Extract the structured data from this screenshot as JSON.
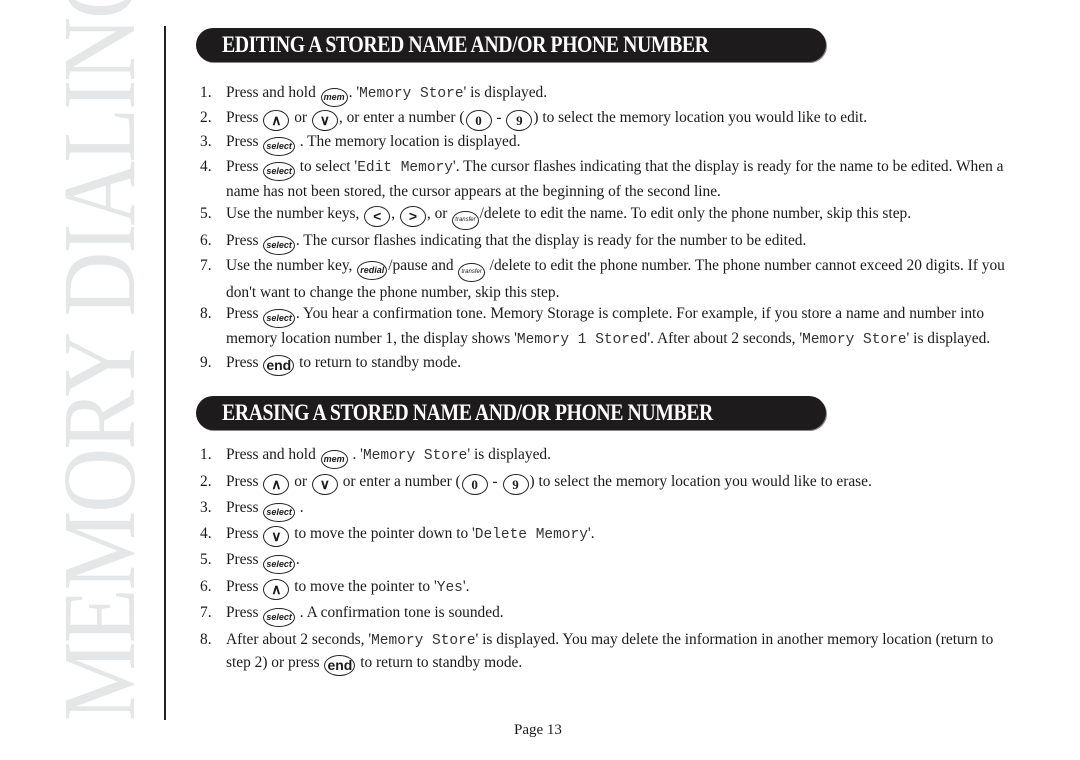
{
  "side_title": "MEMORY DIALING",
  "section1": {
    "title": "EDITING A STORED NAME AND/OR PHONE NUMBER",
    "steps": [
      {
        "n": "1.",
        "parts": [
          {
            "t": "Press and hold "
          },
          {
            "k": "mem"
          },
          {
            "t": ". '"
          },
          {
            "m": "Memory Store"
          },
          {
            "t": "' is displayed."
          }
        ]
      },
      {
        "n": "2.",
        "parts": [
          {
            "t": "Press "
          },
          {
            "k": "∧",
            "c": "big"
          },
          {
            "t": " or "
          },
          {
            "k": "∨",
            "c": "big"
          },
          {
            "t": ", or enter a number ("
          },
          {
            "k": "0",
            "c": "big digit"
          },
          {
            "t": " - "
          },
          {
            "k": "9",
            "c": "big digit"
          },
          {
            "t": ") to select the memory location you would like to edit."
          }
        ]
      },
      {
        "n": "3.",
        "parts": [
          {
            "t": "Press "
          },
          {
            "k": "select"
          },
          {
            "t": " . The memory location is displayed."
          }
        ]
      },
      {
        "n": "4.",
        "parts": [
          {
            "t": "Press "
          },
          {
            "k": "select"
          },
          {
            "t": " to select '"
          },
          {
            "m": "Edit Memory"
          },
          {
            "t": "'. The cursor flashes indicating that the display is ready for the name to be edited. When a name has not been stored, the cursor appears at the beginning of the second line."
          }
        ]
      },
      {
        "n": "5.",
        "parts": [
          {
            "t": "Use the number keys, "
          },
          {
            "k": "<",
            "c": "big"
          },
          {
            "t": ", "
          },
          {
            "k": ">",
            "c": "big"
          },
          {
            "t": ", or  "
          },
          {
            "k": "transfer",
            "c": "tiny"
          },
          {
            "t": "/delete to edit the name. To edit only the phone number, skip this step."
          }
        ]
      },
      {
        "n": "6.",
        "parts": [
          {
            "t": "Press "
          },
          {
            "k": "select"
          },
          {
            "t": ". The cursor flashes indicating that the display is ready for the number to be edited."
          }
        ]
      },
      {
        "n": "7.",
        "parts": [
          {
            "t": "Use the number key, "
          },
          {
            "k": "redial"
          },
          {
            "t": "/pause and  "
          },
          {
            "k": "transfer",
            "c": "tiny"
          },
          {
            "t": " /delete to edit the phone number. The phone number cannot exceed 20 digits. If you don't want to change the phone number, skip this step."
          }
        ]
      },
      {
        "n": "8.",
        "parts": [
          {
            "t": "Press "
          },
          {
            "k": "select"
          },
          {
            "t": ". You hear a confirmation tone. Memory Storage is complete. For example, if you store a name and number into memory location number 1, the display shows '"
          },
          {
            "m": "Memory 1 Stored"
          },
          {
            "t": "'. After about 2 seconds, '"
          },
          {
            "m": "Memory Store"
          },
          {
            "t": "' is displayed."
          }
        ]
      },
      {
        "n": "9.",
        "parts": [
          {
            "t": "Press "
          },
          {
            "k": "end",
            "c": "big"
          },
          {
            "t": " to return to standby mode."
          }
        ]
      }
    ]
  },
  "section2": {
    "title": "ERASING A STORED NAME AND/OR PHONE NUMBER",
    "steps": [
      {
        "n": "1.",
        "parts": [
          {
            "t": "Press and hold "
          },
          {
            "k": "mem"
          },
          {
            "t": " . '"
          },
          {
            "m": "Memory Store"
          },
          {
            "t": "' is displayed."
          }
        ]
      },
      {
        "n": "2.",
        "parts": [
          {
            "t": "Press  "
          },
          {
            "k": "∧",
            "c": "big"
          },
          {
            "t": "  or  "
          },
          {
            "k": "∨",
            "c": "big"
          },
          {
            "t": " or enter a number ("
          },
          {
            "k": "0",
            "c": "big digit"
          },
          {
            "t": " - "
          },
          {
            "k": "9",
            "c": "big digit"
          },
          {
            "t": ") to select the memory location you would like to erase."
          }
        ]
      },
      {
        "n": "3.",
        "parts": [
          {
            "t": "Press  "
          },
          {
            "k": "select"
          },
          {
            "t": " ."
          }
        ]
      },
      {
        "n": "4.",
        "parts": [
          {
            "t": "Press  "
          },
          {
            "k": "∨",
            "c": "big"
          },
          {
            "t": "  to move the pointer down to '"
          },
          {
            "m": "Delete Memory"
          },
          {
            "t": "'."
          }
        ]
      },
      {
        "n": "5.",
        "parts": [
          {
            "t": "Press  "
          },
          {
            "k": "select"
          },
          {
            "t": "."
          }
        ]
      },
      {
        "n": "6.",
        "parts": [
          {
            "t": "Press  "
          },
          {
            "k": "∧",
            "c": "big"
          },
          {
            "t": "  to move the pointer to '"
          },
          {
            "m": "Yes"
          },
          {
            "t": "'."
          }
        ]
      },
      {
        "n": "7.",
        "parts": [
          {
            "t": "Press  "
          },
          {
            "k": "select"
          },
          {
            "t": " . A confirmation tone is sounded."
          }
        ]
      },
      {
        "n": "8.",
        "parts": [
          {
            "t": "After about 2 seconds, '"
          },
          {
            "m": "Memory Store"
          },
          {
            "t": "' is displayed. You may delete the information in another memory location (return to step 2) or press "
          },
          {
            "k": "end",
            "c": "big"
          },
          {
            "t": " to return to standby mode."
          }
        ]
      }
    ]
  },
  "footer": {
    "page_label": "Page 13"
  }
}
